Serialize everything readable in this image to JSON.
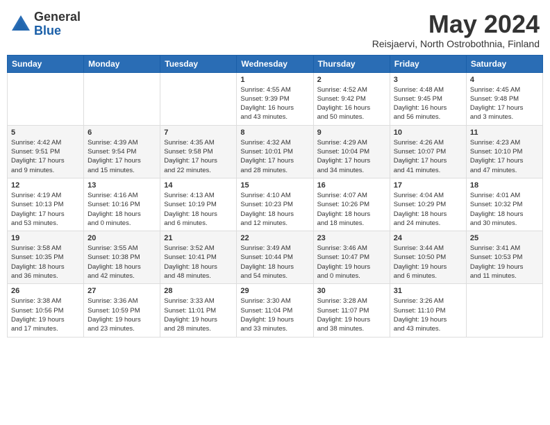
{
  "logo": {
    "general": "General",
    "blue": "Blue"
  },
  "title": {
    "month": "May 2024",
    "location": "Reisjaervi, North Ostrobothnia, Finland"
  },
  "weekdays": [
    "Sunday",
    "Monday",
    "Tuesday",
    "Wednesday",
    "Thursday",
    "Friday",
    "Saturday"
  ],
  "weeks": [
    [
      {
        "day": "",
        "info": ""
      },
      {
        "day": "",
        "info": ""
      },
      {
        "day": "",
        "info": ""
      },
      {
        "day": "1",
        "info": "Sunrise: 4:55 AM\nSunset: 9:39 PM\nDaylight: 16 hours\nand 43 minutes."
      },
      {
        "day": "2",
        "info": "Sunrise: 4:52 AM\nSunset: 9:42 PM\nDaylight: 16 hours\nand 50 minutes."
      },
      {
        "day": "3",
        "info": "Sunrise: 4:48 AM\nSunset: 9:45 PM\nDaylight: 16 hours\nand 56 minutes."
      },
      {
        "day": "4",
        "info": "Sunrise: 4:45 AM\nSunset: 9:48 PM\nDaylight: 17 hours\nand 3 minutes."
      }
    ],
    [
      {
        "day": "5",
        "info": "Sunrise: 4:42 AM\nSunset: 9:51 PM\nDaylight: 17 hours\nand 9 minutes."
      },
      {
        "day": "6",
        "info": "Sunrise: 4:39 AM\nSunset: 9:54 PM\nDaylight: 17 hours\nand 15 minutes."
      },
      {
        "day": "7",
        "info": "Sunrise: 4:35 AM\nSunset: 9:58 PM\nDaylight: 17 hours\nand 22 minutes."
      },
      {
        "day": "8",
        "info": "Sunrise: 4:32 AM\nSunset: 10:01 PM\nDaylight: 17 hours\nand 28 minutes."
      },
      {
        "day": "9",
        "info": "Sunrise: 4:29 AM\nSunset: 10:04 PM\nDaylight: 17 hours\nand 34 minutes."
      },
      {
        "day": "10",
        "info": "Sunrise: 4:26 AM\nSunset: 10:07 PM\nDaylight: 17 hours\nand 41 minutes."
      },
      {
        "day": "11",
        "info": "Sunrise: 4:23 AM\nSunset: 10:10 PM\nDaylight: 17 hours\nand 47 minutes."
      }
    ],
    [
      {
        "day": "12",
        "info": "Sunrise: 4:19 AM\nSunset: 10:13 PM\nDaylight: 17 hours\nand 53 minutes."
      },
      {
        "day": "13",
        "info": "Sunrise: 4:16 AM\nSunset: 10:16 PM\nDaylight: 18 hours\nand 0 minutes."
      },
      {
        "day": "14",
        "info": "Sunrise: 4:13 AM\nSunset: 10:19 PM\nDaylight: 18 hours\nand 6 minutes."
      },
      {
        "day": "15",
        "info": "Sunrise: 4:10 AM\nSunset: 10:23 PM\nDaylight: 18 hours\nand 12 minutes."
      },
      {
        "day": "16",
        "info": "Sunrise: 4:07 AM\nSunset: 10:26 PM\nDaylight: 18 hours\nand 18 minutes."
      },
      {
        "day": "17",
        "info": "Sunrise: 4:04 AM\nSunset: 10:29 PM\nDaylight: 18 hours\nand 24 minutes."
      },
      {
        "day": "18",
        "info": "Sunrise: 4:01 AM\nSunset: 10:32 PM\nDaylight: 18 hours\nand 30 minutes."
      }
    ],
    [
      {
        "day": "19",
        "info": "Sunrise: 3:58 AM\nSunset: 10:35 PM\nDaylight: 18 hours\nand 36 minutes."
      },
      {
        "day": "20",
        "info": "Sunrise: 3:55 AM\nSunset: 10:38 PM\nDaylight: 18 hours\nand 42 minutes."
      },
      {
        "day": "21",
        "info": "Sunrise: 3:52 AM\nSunset: 10:41 PM\nDaylight: 18 hours\nand 48 minutes."
      },
      {
        "day": "22",
        "info": "Sunrise: 3:49 AM\nSunset: 10:44 PM\nDaylight: 18 hours\nand 54 minutes."
      },
      {
        "day": "23",
        "info": "Sunrise: 3:46 AM\nSunset: 10:47 PM\nDaylight: 19 hours\nand 0 minutes."
      },
      {
        "day": "24",
        "info": "Sunrise: 3:44 AM\nSunset: 10:50 PM\nDaylight: 19 hours\nand 6 minutes."
      },
      {
        "day": "25",
        "info": "Sunrise: 3:41 AM\nSunset: 10:53 PM\nDaylight: 19 hours\nand 11 minutes."
      }
    ],
    [
      {
        "day": "26",
        "info": "Sunrise: 3:38 AM\nSunset: 10:56 PM\nDaylight: 19 hours\nand 17 minutes."
      },
      {
        "day": "27",
        "info": "Sunrise: 3:36 AM\nSunset: 10:59 PM\nDaylight: 19 hours\nand 23 minutes."
      },
      {
        "day": "28",
        "info": "Sunrise: 3:33 AM\nSunset: 11:01 PM\nDaylight: 19 hours\nand 28 minutes."
      },
      {
        "day": "29",
        "info": "Sunrise: 3:30 AM\nSunset: 11:04 PM\nDaylight: 19 hours\nand 33 minutes."
      },
      {
        "day": "30",
        "info": "Sunrise: 3:28 AM\nSunset: 11:07 PM\nDaylight: 19 hours\nand 38 minutes."
      },
      {
        "day": "31",
        "info": "Sunrise: 3:26 AM\nSunset: 11:10 PM\nDaylight: 19 hours\nand 43 minutes."
      },
      {
        "day": "",
        "info": ""
      }
    ]
  ]
}
